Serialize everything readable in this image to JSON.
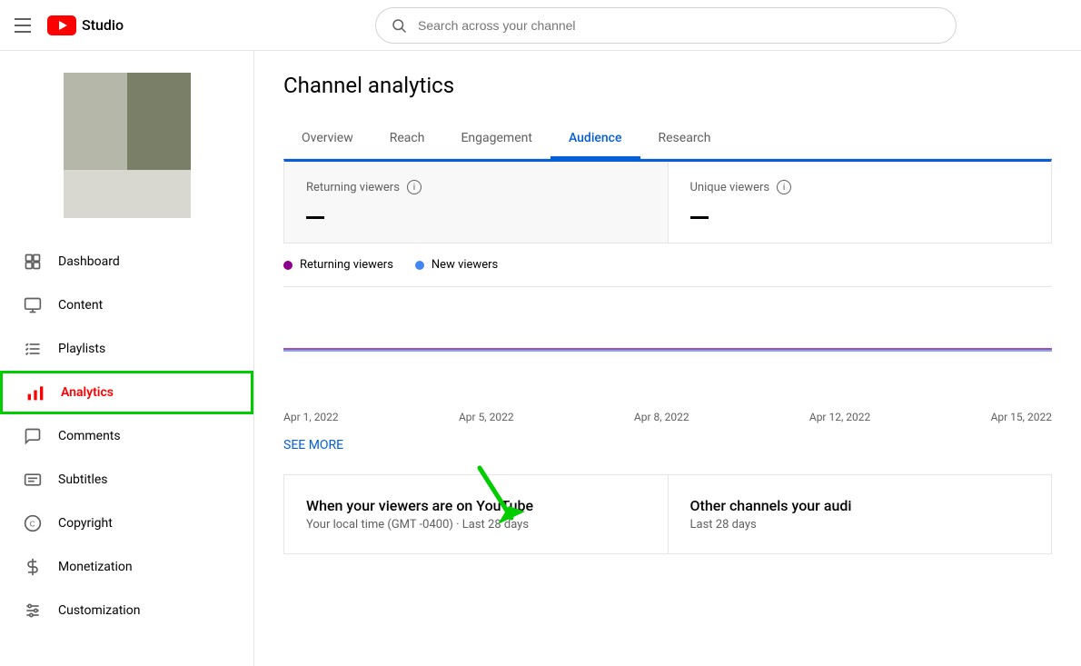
{
  "header": {
    "hamburger_label": "Menu",
    "logo_text": "Studio",
    "search_placeholder": "Search across your channel"
  },
  "sidebar": {
    "items": [
      {
        "id": "dashboard",
        "label": "Dashboard",
        "icon": "dashboard"
      },
      {
        "id": "content",
        "label": "Content",
        "icon": "content"
      },
      {
        "id": "playlists",
        "label": "Playlists",
        "icon": "playlists"
      },
      {
        "id": "analytics",
        "label": "Analytics",
        "icon": "analytics",
        "active": true
      },
      {
        "id": "comments",
        "label": "Comments",
        "icon": "comments"
      },
      {
        "id": "subtitles",
        "label": "Subtitles",
        "icon": "subtitles"
      },
      {
        "id": "copyright",
        "label": "Copyright",
        "icon": "copyright"
      },
      {
        "id": "monetization",
        "label": "Monetization",
        "icon": "monetization"
      },
      {
        "id": "customization",
        "label": "Customization",
        "icon": "customization"
      }
    ]
  },
  "main": {
    "page_title": "Channel analytics",
    "tabs": [
      {
        "id": "overview",
        "label": "Overview"
      },
      {
        "id": "reach",
        "label": "Reach"
      },
      {
        "id": "engagement",
        "label": "Engagement"
      },
      {
        "id": "audience",
        "label": "Audience",
        "active": true
      },
      {
        "id": "research",
        "label": "Research"
      }
    ],
    "metrics": [
      {
        "label": "Returning viewers",
        "value": "—"
      },
      {
        "label": "Unique viewers",
        "value": "—"
      }
    ],
    "legend": [
      {
        "label": "Returning viewers",
        "color": "#8B008B"
      },
      {
        "label": "New viewers",
        "color": "#4285f4"
      }
    ],
    "chart_dates": [
      "Apr 1, 2022",
      "Apr 5, 2022",
      "Apr 8, 2022",
      "Apr 12, 2022",
      "Apr 15, 2022"
    ],
    "see_more": "SEE MORE",
    "bottom_cards": [
      {
        "title": "When your viewers are on YouTube",
        "subtitle": "Your local time (GMT -0400) · Last 28 days"
      },
      {
        "title": "Other channels your audi",
        "subtitle": "Last 28 days"
      }
    ]
  }
}
